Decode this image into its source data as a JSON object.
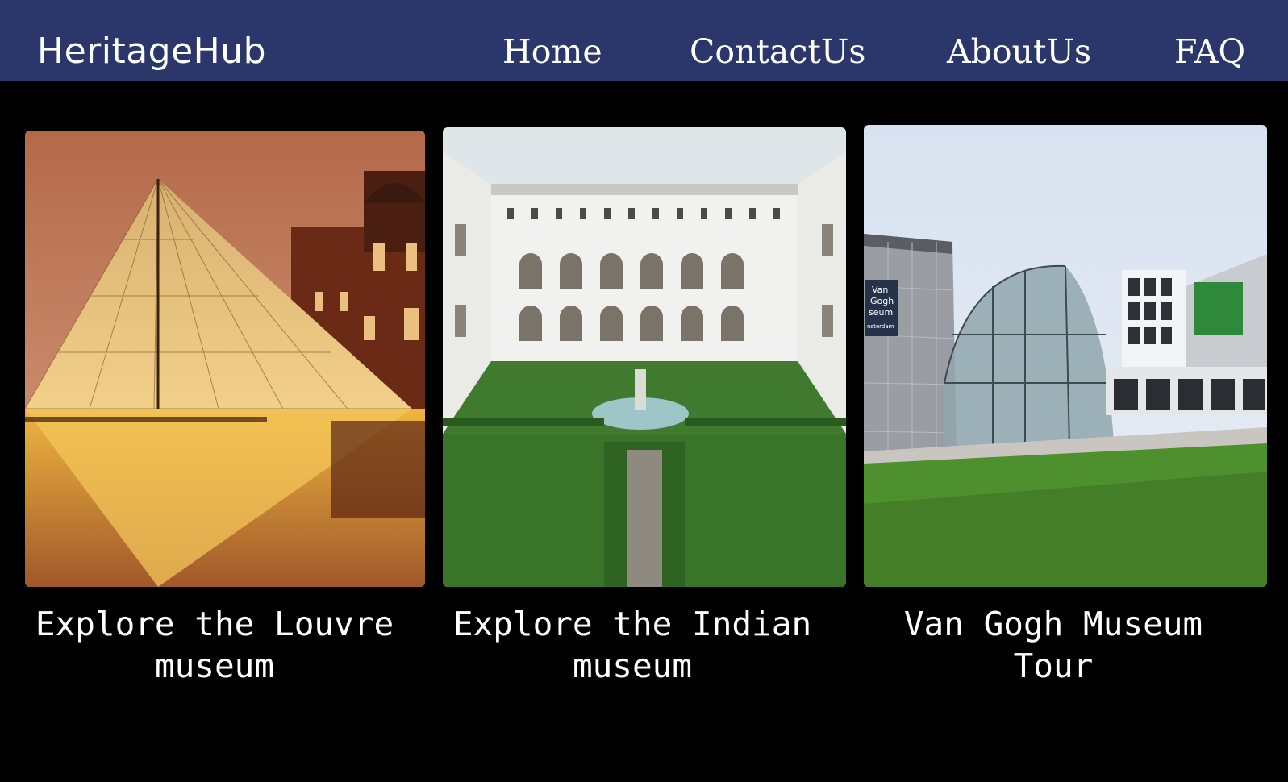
{
  "header": {
    "logo": "HeritageHub",
    "nav": [
      {
        "label": "Home"
      },
      {
        "label": "ContactUs"
      },
      {
        "label": "AboutUs"
      },
      {
        "label": "FAQ"
      }
    ]
  },
  "cards": [
    {
      "caption": "Explore the Louvre museum",
      "image": "louvre-pyramid-image"
    },
    {
      "caption": "Explore the Indian museum",
      "image": "indian-museum-courtyard-image"
    },
    {
      "caption": "Van Gogh Museum Tour",
      "image": "van-gogh-museum-image",
      "image_sign_text": "Van Gogh Museum Amsterdam"
    }
  ],
  "colors": {
    "navbar": "#2b366b",
    "background": "#000000",
    "text": "#ffffff"
  }
}
